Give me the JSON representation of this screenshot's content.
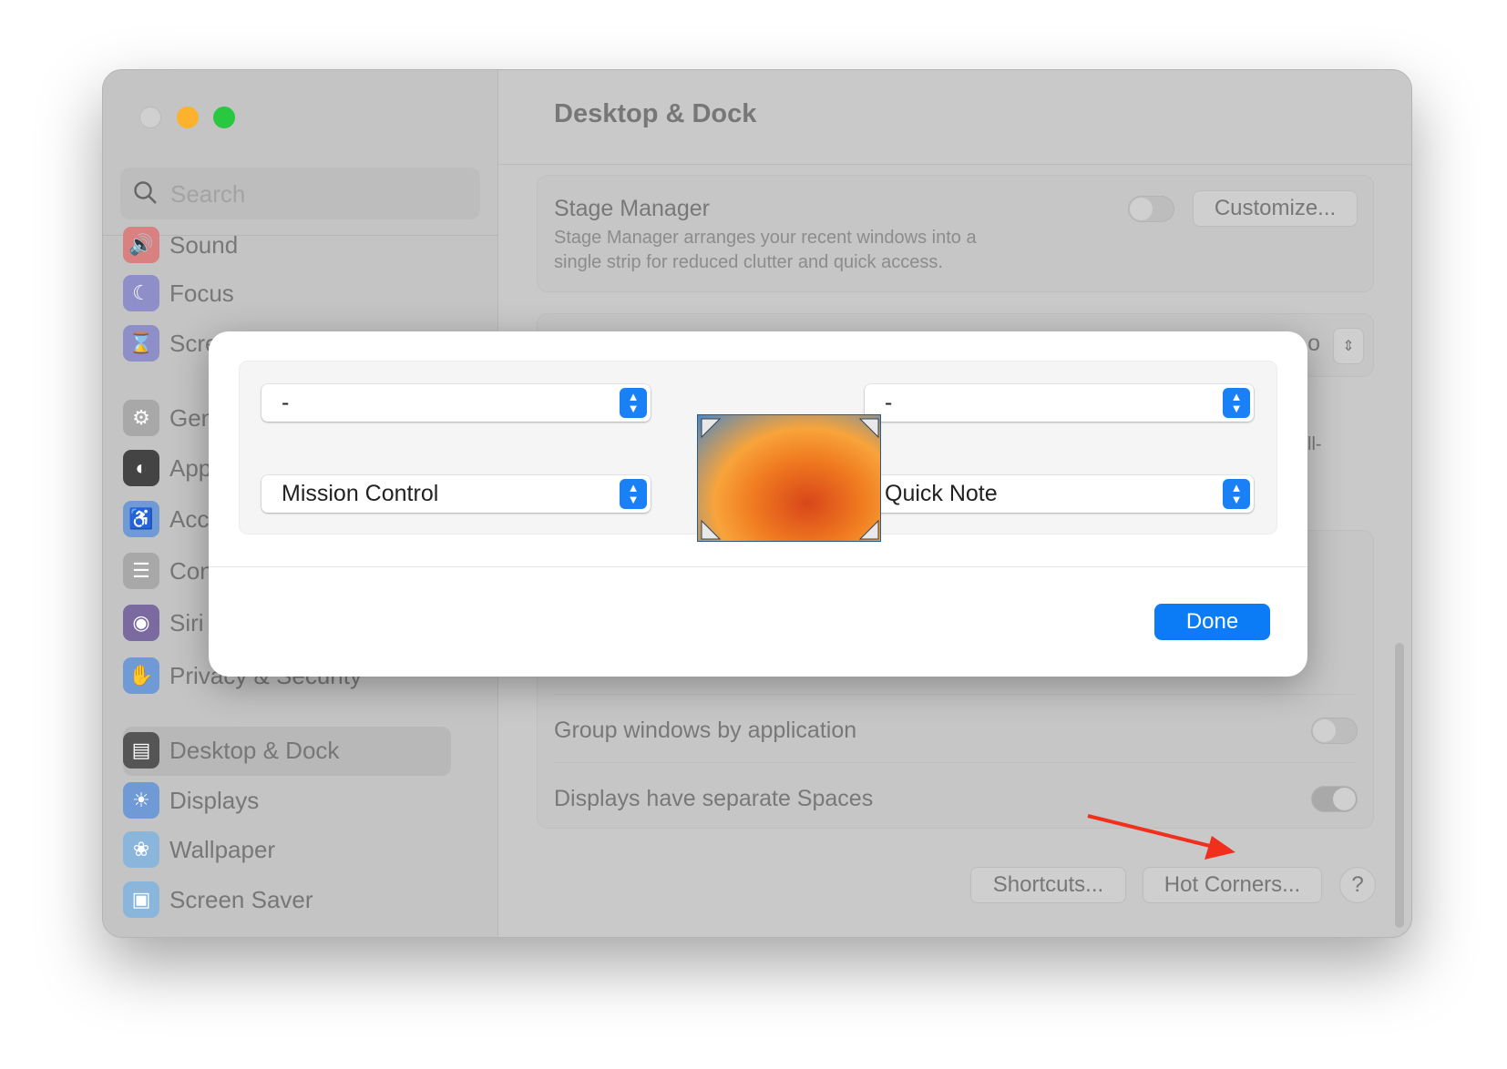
{
  "window": {
    "title": "Desktop & Dock",
    "traffic_lights": {
      "close": "#d0d0d0",
      "minimize": "#fdb22e",
      "zoom": "#28c840"
    }
  },
  "sidebar": {
    "search_placeholder": "Search",
    "items": [
      {
        "label": "Sound",
        "icon": "speaker-icon",
        "color": "#d98080"
      },
      {
        "label": "Focus",
        "icon": "moon-icon",
        "color": "#8e8ec8"
      },
      {
        "label": "Screen Time",
        "icon": "hourglass-icon",
        "color": "#8e8ec8"
      },
      {
        "label": "General",
        "icon": "gear-icon",
        "color": "#a8a8a8"
      },
      {
        "label": "Appearance",
        "icon": "appearance-icon",
        "color": "#444444"
      },
      {
        "label": "Accessibility",
        "icon": "accessibility-icon",
        "color": "#6f9ad6"
      },
      {
        "label": "Control Center",
        "icon": "toggles-icon",
        "color": "#a8a8a8"
      },
      {
        "label": "Siri & Spotlight",
        "icon": "siri-icon",
        "color": "#7a6aa0"
      },
      {
        "label": "Privacy & Security",
        "icon": "hand-icon",
        "color": "#6f9ad6"
      },
      {
        "label": "Desktop & Dock",
        "icon": "dock-icon",
        "color": "#555555",
        "selected": true
      },
      {
        "label": "Displays",
        "icon": "sun-icon",
        "color": "#6f9ad6"
      },
      {
        "label": "Wallpaper",
        "icon": "flower-icon",
        "color": "#8ab6dc"
      },
      {
        "label": "Screen Saver",
        "icon": "screensaver-icon",
        "color": "#8ab6dc"
      }
    ]
  },
  "main": {
    "stage_manager": {
      "title": "Stage Manager",
      "description_1": "Stage Manager arranges your recent windows into a",
      "description_2": "single strip for reduced clutter and quick access.",
      "enabled": false,
      "customize_label": "Customize..."
    },
    "partial_text_1": "o",
    "partial_text_2": "ll-",
    "rows": [
      {
        "label": "Group windows by application",
        "enabled": false
      },
      {
        "label": "Displays have separate Spaces",
        "enabled": true
      }
    ],
    "buttons": {
      "shortcuts": "Shortcuts...",
      "hot_corners": "Hot Corners...",
      "help": "?"
    }
  },
  "hot_corners_dialog": {
    "top_left": "-",
    "top_right": "-",
    "bottom_left": "Mission Control",
    "bottom_right": "Quick Note",
    "done_label": "Done",
    "accent": "#0b7cf5"
  },
  "annotation": {
    "arrow_color": "#f0301c"
  }
}
